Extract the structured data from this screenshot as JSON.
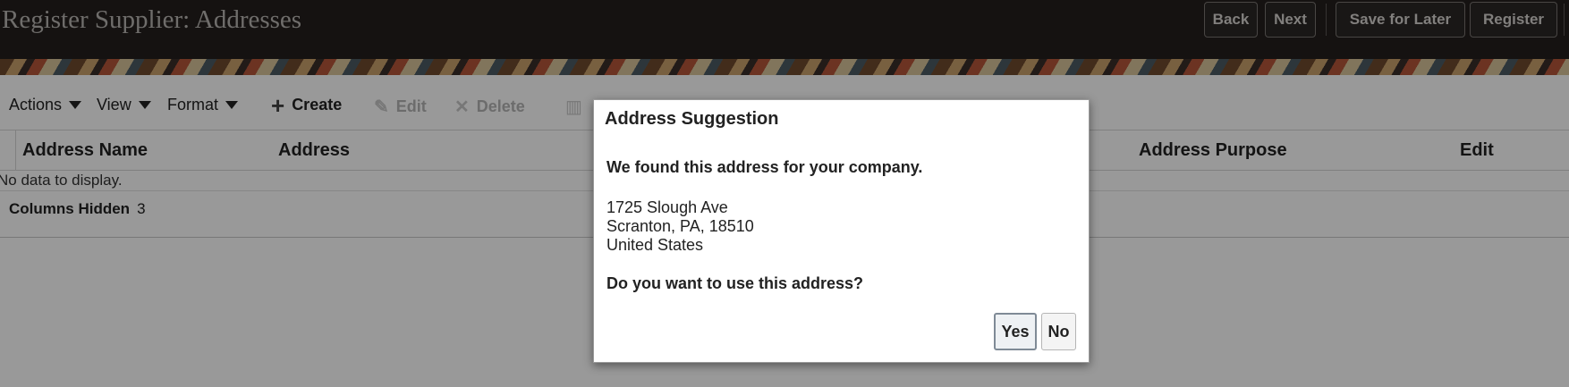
{
  "header": {
    "title": "Register Supplier: Addresses",
    "back_label": "Back",
    "next_label": "Next",
    "save_label": "Save for Later",
    "register_label": "Register"
  },
  "toolbar": {
    "actions": "Actions",
    "view": "View",
    "format": "Format",
    "create": "Create",
    "edit": "Edit",
    "delete": "Delete"
  },
  "table": {
    "columns": [
      "Address Name",
      "Address",
      "Address Purpose",
      "Edit"
    ],
    "empty_text": "No data to display.",
    "columns_hidden_label": "Columns Hidden",
    "columns_hidden_count": "3"
  },
  "dialog": {
    "title": "Address Suggestion",
    "intro": "We found this address for your company.",
    "address_lines": [
      "1725 Slough Ave",
      "Scranton, PA, 18510",
      "United States"
    ],
    "question": "Do you want to use this address?",
    "yes_label": "Yes",
    "no_label": "No"
  }
}
